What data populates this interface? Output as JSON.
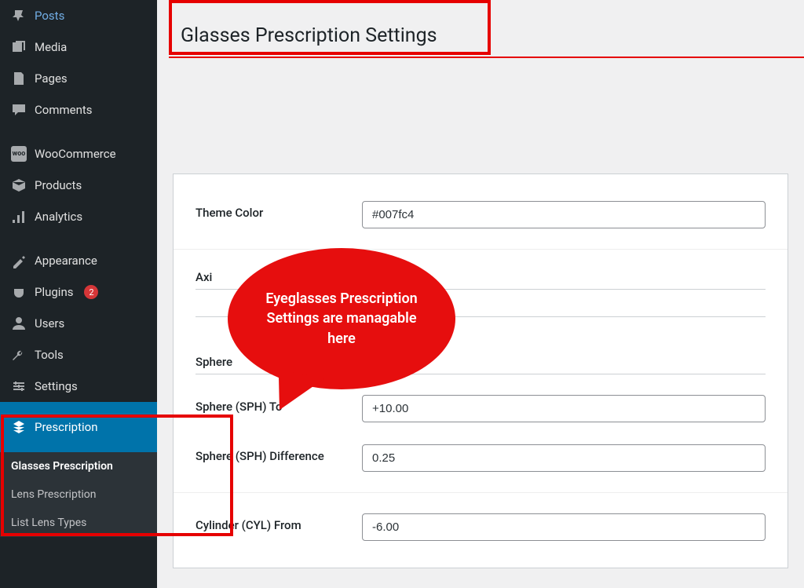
{
  "sidebar": {
    "items": [
      {
        "label": "Posts",
        "icon": "pin"
      },
      {
        "label": "Media",
        "icon": "media"
      },
      {
        "label": "Pages",
        "icon": "pages"
      },
      {
        "label": "Comments",
        "icon": "comments"
      },
      {
        "label": "WooCommerce",
        "icon": "woo"
      },
      {
        "label": "Products",
        "icon": "products"
      },
      {
        "label": "Analytics",
        "icon": "analytics"
      },
      {
        "label": "Appearance",
        "icon": "appearance"
      },
      {
        "label": "Plugins",
        "icon": "plugins",
        "badge": "2"
      },
      {
        "label": "Users",
        "icon": "users"
      },
      {
        "label": "Tools",
        "icon": "tools"
      },
      {
        "label": "Settings",
        "icon": "settings"
      }
    ],
    "active": {
      "label": "Prescription",
      "icon": "prescription"
    },
    "submenu": [
      {
        "label": "Glasses Prescription",
        "current": true
      },
      {
        "label": "Lens Prescription",
        "current": false
      },
      {
        "label": "List Lens Types",
        "current": false
      }
    ]
  },
  "page": {
    "title": "Glasses Prescription Settings"
  },
  "callout": {
    "text": "Eyeglasses Prescription Settings are managable here"
  },
  "fields": {
    "theme_color": {
      "label": "Theme Color",
      "value": "#007fc4"
    },
    "axis": {
      "label": "Axi"
    },
    "sphere_partial": {
      "label": "Sphere"
    },
    "sph_to": {
      "label": "Sphere (SPH) To",
      "value": "+10.00"
    },
    "sph_diff": {
      "label": "Sphere (SPH) Difference",
      "value": "0.25"
    },
    "cyl_from": {
      "label": "Cylinder (CYL) From",
      "value": "-6.00"
    }
  }
}
